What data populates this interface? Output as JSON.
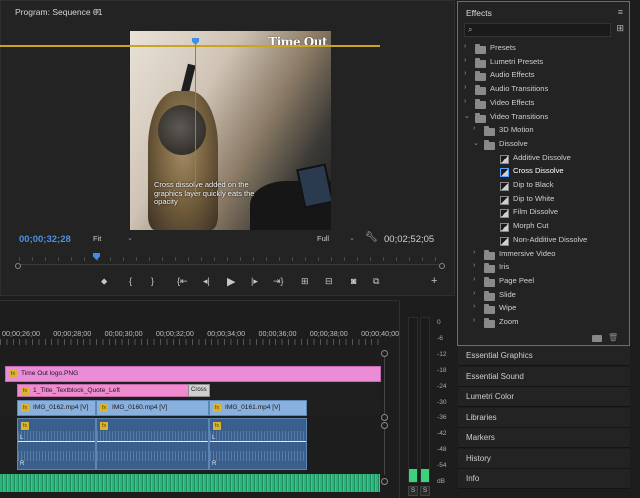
{
  "program_monitor": {
    "title": "Program: Sequence 01",
    "menu_icon": "hamburger-menu-icon",
    "video_logo": "Time Out",
    "video_caption": "Cross dissolve added on the graphics layer quickly eats the opacity",
    "timecode_current": "00;00;32;28",
    "fit_value": "Fit",
    "resolution_value": "Full",
    "timecode_duration": "00;02;52;05",
    "transport_icons": [
      "add-marker-icon",
      "mark-in-icon",
      "mark-out-icon",
      "go-to-in-icon",
      "step-back-icon",
      "play-icon",
      "step-forward-icon",
      "go-to-out-icon",
      "lift-icon",
      "extract-icon",
      "export-frame-icon",
      "comparison-view-icon",
      "add-button-icon"
    ]
  },
  "effects_panel": {
    "title": "Effects",
    "menu_icon": "hamburger-menu-icon",
    "search_placeholder": "",
    "tree": [
      {
        "label": "Presets",
        "level": 0,
        "type": "folder",
        "expanded": false,
        "special": true
      },
      {
        "label": "Lumetri Presets",
        "level": 0,
        "type": "folder",
        "expanded": false,
        "special": true
      },
      {
        "label": "Audio Effects",
        "level": 0,
        "type": "folder",
        "expanded": false
      },
      {
        "label": "Audio Transitions",
        "level": 0,
        "type": "folder",
        "expanded": false
      },
      {
        "label": "Video Effects",
        "level": 0,
        "type": "folder",
        "expanded": false
      },
      {
        "label": "Video Transitions",
        "level": 0,
        "type": "folder",
        "expanded": true
      },
      {
        "label": "3D Motion",
        "level": 1,
        "type": "folder",
        "expanded": false
      },
      {
        "label": "Dissolve",
        "level": 1,
        "type": "folder",
        "expanded": true
      },
      {
        "label": "Additive Dissolve",
        "level": 2,
        "type": "effect"
      },
      {
        "label": "Cross Dissolve",
        "level": 2,
        "type": "effect",
        "selected": true
      },
      {
        "label": "Dip to Black",
        "level": 2,
        "type": "effect"
      },
      {
        "label": "Dip to White",
        "level": 2,
        "type": "effect"
      },
      {
        "label": "Film Dissolve",
        "level": 2,
        "type": "effect"
      },
      {
        "label": "Morph Cut",
        "level": 2,
        "type": "effect"
      },
      {
        "label": "Non-Additive Dissolve",
        "level": 2,
        "type": "effect"
      },
      {
        "label": "Immersive Video",
        "level": 1,
        "type": "folder",
        "expanded": false
      },
      {
        "label": "Iris",
        "level": 1,
        "type": "folder",
        "expanded": false
      },
      {
        "label": "Page Peel",
        "level": 1,
        "type": "folder",
        "expanded": false
      },
      {
        "label": "Slide",
        "level": 1,
        "type": "folder",
        "expanded": false
      },
      {
        "label": "Wipe",
        "level": 1,
        "type": "folder",
        "expanded": false
      },
      {
        "label": "Zoom",
        "level": 1,
        "type": "folder",
        "expanded": false
      }
    ]
  },
  "side_panels": [
    "Essential Graphics",
    "Essential Sound",
    "Lumetri Color",
    "Libraries",
    "Markers",
    "History",
    "Info"
  ],
  "timeline": {
    "ruler_labels": [
      "00;00;26;00",
      "00;00;28;00",
      "00;00;30;00",
      "00;00;32;00",
      "00;00;34;00",
      "00;00;36;00",
      "00;00;38;00",
      "00;00;40;00"
    ],
    "clips": {
      "logo": "Time Out logo.PNG",
      "title": "1_Title_Textblock_Quote_Left",
      "transition": "Cross",
      "video1": "IMG_0162.mp4 [V]",
      "video2": "IMG_0160.mp4 [V]",
      "video3": "IMG_0161.mp4 [V]"
    },
    "fx_badge": "fx",
    "audio_channels": [
      "L",
      "R"
    ]
  },
  "audio_meters": {
    "scale": [
      "0",
      "-6",
      "-12",
      "-18",
      "-24",
      "-30",
      "-36",
      "-42",
      "-48",
      "-54",
      "dB"
    ],
    "solo_buttons": [
      "S",
      "S"
    ],
    "colors": {
      "meter_top": "#2a2a2a",
      "meter_fill": "#3ad27a"
    }
  },
  "colors": {
    "accent_blue": "#3e8ee8",
    "logo_clip": "#ea8cd8",
    "title_clip": "#f08bd0",
    "video_clip": "#8ab0dd",
    "audio_green": "#2ab37a",
    "work_area": "#c8a420"
  }
}
